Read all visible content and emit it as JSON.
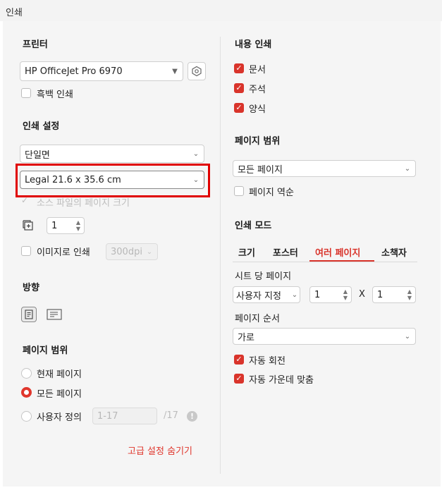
{
  "window": {
    "title": "인쇄"
  },
  "left": {
    "printer": {
      "heading": "프린터",
      "selected": "HP OfficeJet Pro 6970",
      "grayscale_label": "흑백 인쇄",
      "grayscale_checked": false
    },
    "print_settings": {
      "heading": "인쇄 설정",
      "duplex": "단일면",
      "paper_size": "Legal 21.6 x 35.6 cm",
      "source_page_size_label": "소스 파일의 페이지 크기",
      "copies": "1",
      "print_as_image_label": "이미지로 인쇄",
      "dpi": "300dpi"
    },
    "orientation": {
      "heading": "방향"
    },
    "page_range": {
      "heading": "페이지 범위",
      "current_page": "현재 페이지",
      "all_pages": "모든 페이지",
      "custom": "사용자 정의",
      "custom_value": "1-17",
      "total": "/17",
      "info": "!"
    },
    "hide_advanced": "고급 설정 숨기기"
  },
  "right": {
    "content": {
      "heading": "내용 인쇄",
      "items": [
        {
          "label": "문서",
          "checked": true
        },
        {
          "label": "주석",
          "checked": true
        },
        {
          "label": "양식",
          "checked": true
        }
      ]
    },
    "page_range": {
      "heading": "페이지 범위",
      "selected": "모든 페이지",
      "reverse_label": "페이지 역순"
    },
    "print_mode": {
      "heading": "인쇄 모드",
      "tabs": [
        "크기",
        "포스터",
        "여러 페이지",
        "소책자"
      ],
      "active_tab": "여러 페이지",
      "pages_per_sheet_label": "시트 당 페이지",
      "pages_per_sheet_value": "사용자 지정",
      "cols": "1",
      "x": "X",
      "rows": "1",
      "page_order_label": "페이지 순서",
      "page_order_value": "가로",
      "auto_rotate": "자동 회전",
      "auto_center": "자동 가운데 맞춤"
    }
  },
  "colors": {
    "accent": "#d9342b",
    "highlight": "#e00000"
  }
}
